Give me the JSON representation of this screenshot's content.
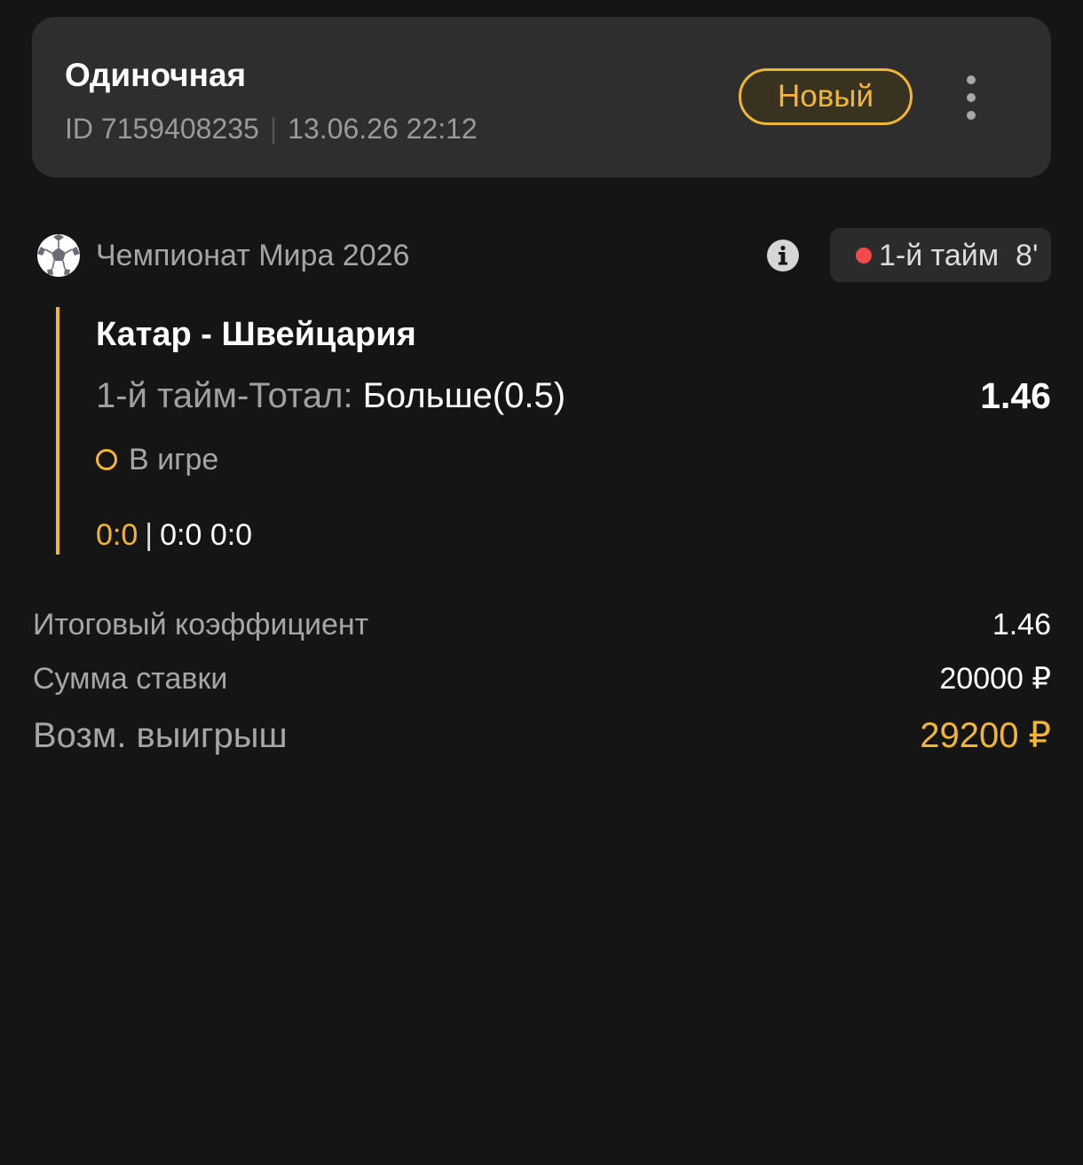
{
  "bet_card": {
    "type": "Одиночная",
    "id_text": "ID 7159408235",
    "datetime": "13.06.26 22:12",
    "status": "Новый",
    "menu_icon": "kebab-menu-icon"
  },
  "event": {
    "sport_icon": "soccer-ball-icon",
    "tournament": "Чемпионат Мира 2026",
    "info_icon": "info-icon",
    "live_status": "1-й тайм  8'",
    "teams": "Катар - Швейцария",
    "market_label": "1-й тайм-Тотал: ",
    "market_value": "Больше(0.5)",
    "odds": "1.46",
    "state": "В игре",
    "score_main": "0:0",
    "score_separator": "|",
    "score_periods": "0:0 0:0"
  },
  "summary": {
    "total_coef_label": "Итоговый коэффициент",
    "total_coef_value": "1.46",
    "stake_label": "Сумма ставки",
    "stake_value": "20000 ₽",
    "win_label": "Возм. выигрыш",
    "win_value": "29200 ₽"
  },
  "colors": {
    "background": "#151515",
    "card": "#2e2e2e",
    "accent": "#f2b632",
    "live_dot": "#f24a4a"
  }
}
